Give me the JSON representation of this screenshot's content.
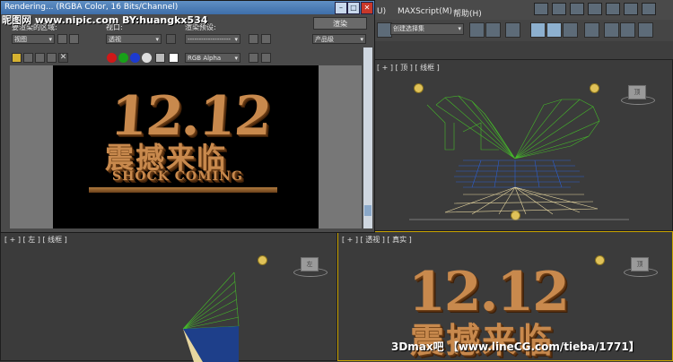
{
  "menubar": {
    "item_u": "U)",
    "maxscript": "MAXScript(M)",
    "help": "帮助(H)"
  },
  "toolbar": {
    "selection_set": "创建选择集"
  },
  "render_window": {
    "title": "Rendering... (RGBA Color, 16 Bits/Channel)",
    "area_label": "要渲染的区域:",
    "area_value": "视图",
    "viewport_label": "视口:",
    "viewport_value": "透视",
    "preset_label": "渲染预设:",
    "preset_value": "-------------------",
    "render_button": "渲染",
    "product_value": "产品级",
    "channel_value": "RGB Alpha",
    "swatch_colors": [
      "#d01818",
      "#18a018",
      "#1c3ad0",
      "#dddddd"
    ],
    "headline_number": "12.12",
    "headline_cn": "震撼来临",
    "headline_en": "SHOCK COMING"
  },
  "viewports": {
    "top_right": {
      "label": "[ + ] [ 顶 ] [ 线框 ]",
      "cube": "顶"
    },
    "bottom_left": {
      "label": "[ + ] [ 左 ] [ 线框 ]",
      "cube": "左"
    },
    "bottom_right": {
      "label": "[ + ] [ 透视 ] [ 真实 ]",
      "cube": "顶"
    },
    "bottom_right_text": "12.12",
    "bottom_right_cn": "震撼来临"
  },
  "watermarks": {
    "top": "昵图网  www.nipic.com    BY:huangkx534",
    "bottom": "3Dmax吧 【www.lineCG.com/tieba/1771】"
  },
  "colors": {
    "wire_green": "#45b82a",
    "wire_blue": "#2d5fd0",
    "wire_tan": "#e6d6a0",
    "bronze": "#c8894d"
  }
}
